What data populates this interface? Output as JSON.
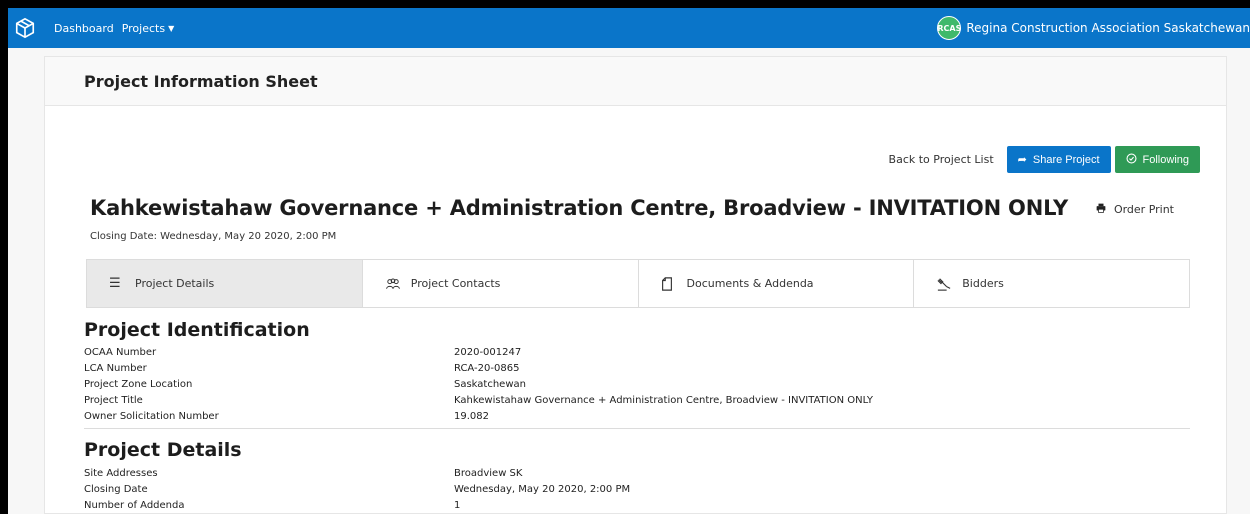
{
  "nav": {
    "dashboard": "Dashboard",
    "projects": "Projects",
    "avatar_initials": "RCAS",
    "org_name": "Regina Construction Association Saskatchewan"
  },
  "header": {
    "title": "Project Information Sheet"
  },
  "actions": {
    "back": "Back to Project List",
    "share": "Share Project",
    "follow": "Following"
  },
  "project": {
    "title": "Kahkewistahaw Governance + Administration Centre, Broadview - INVITATION ONLY",
    "order_print": "Order Print",
    "closing": "Closing Date: Wednesday, May 20 2020, 2:00 PM"
  },
  "tabs": [
    {
      "label": "Project Details",
      "icon": "list-icon"
    },
    {
      "label": "Project Contacts",
      "icon": "people-icon"
    },
    {
      "label": "Documents & Addenda",
      "icon": "document-icon"
    },
    {
      "label": "Bidders",
      "icon": "gavel-icon"
    }
  ],
  "identification": {
    "title": "Project Identification",
    "rows": [
      {
        "label": "OCAA Number",
        "value": "2020-001247"
      },
      {
        "label": "LCA Number",
        "value": "RCA-20-0865"
      },
      {
        "label": "Project Zone Location",
        "value": "Saskatchewan"
      },
      {
        "label": "Project Title",
        "value": "Kahkewistahaw Governance + Administration Centre, Broadview - INVITATION ONLY"
      },
      {
        "label": "Owner Solicitation Number",
        "value": "19.082"
      }
    ]
  },
  "details": {
    "title": "Project Details",
    "rows": [
      {
        "label": "Site Addresses",
        "value": "Broadview SK"
      },
      {
        "label": "Closing Date",
        "value": "Wednesday, May 20 2020, 2:00 PM"
      },
      {
        "label": "Number of Addenda",
        "value": "1"
      }
    ]
  },
  "colors": {
    "primary": "#0a75c9",
    "success": "#2f9a56",
    "avatar": "#3fb96b"
  }
}
